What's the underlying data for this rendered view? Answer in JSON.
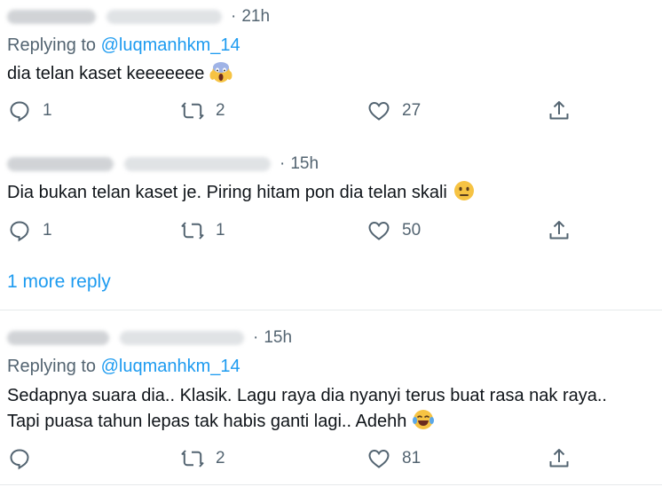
{
  "tweets": [
    {
      "time": "21h",
      "replying_prefix": "Replying to ",
      "replying_handle": "@luqmanhkm_14",
      "text": "dia telan kaset keeeeeee",
      "emoji": "screaming-face-emoji",
      "reply_count": "1",
      "retweet_count": "2",
      "like_count": "27"
    },
    {
      "time": "15h",
      "text": "Dia bukan telan kaset je. Piring hitam pon dia telan skali",
      "emoji": "neutral-face-emoji",
      "reply_count": "1",
      "retweet_count": "1",
      "like_count": "50"
    },
    {
      "time": "15h",
      "replying_prefix": "Replying to ",
      "replying_handle": "@luqmanhkm_14",
      "text_line1": "Sedapnya suara dia.. Klasik. Lagu raya dia nyanyi terus buat rasa nak raya..",
      "text_line2": "Tapi puasa tahun lepas tak habis ganti lagi.. Adehh",
      "emoji": "tears-of-joy-emoji",
      "reply_count": "",
      "retweet_count": "2",
      "like_count": "81"
    }
  ],
  "more_replies": "1 more reply",
  "colors": {
    "text": "#0f1419",
    "secondary": "#536471",
    "link": "#1d9bf0",
    "divider": "#e6e9eb"
  }
}
